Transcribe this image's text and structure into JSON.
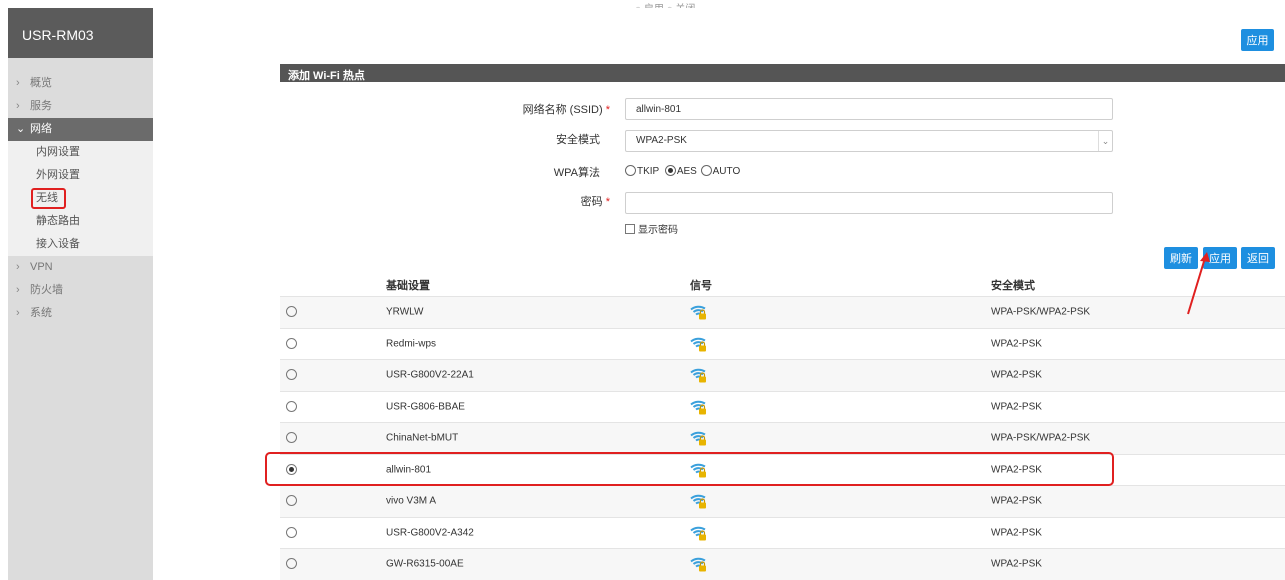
{
  "brand": "USR-RM03",
  "nav": {
    "overview": "概览",
    "services": "服务",
    "network": "网络",
    "network_sub": [
      "内网设置",
      "外网设置",
      "无线",
      "静态路由",
      "接入设备"
    ],
    "vpn": "VPN",
    "firewall": "防火墙",
    "system": "系统"
  },
  "top": {
    "apply_label": "应用",
    "cut_text": "○ 启用                          ○ 关闭"
  },
  "section": {
    "title": "添加 Wi-Fi 热点"
  },
  "form": {
    "ssid_label": "网络名称 (SSID)",
    "ssid_value": "allwin-801",
    "security_label": "安全模式",
    "security_value": "WPA2-PSK",
    "wpa_label": "WPA算法",
    "wpa_options": [
      "TKIP",
      "AES",
      "AUTO"
    ],
    "wpa_selected": "AES",
    "password_label": "密码",
    "password_value": "",
    "show_password_label": "显示密码",
    "required_mark": "*"
  },
  "buttons": {
    "refresh": "刷新",
    "apply": "应用",
    "back": "返回"
  },
  "table": {
    "headers": {
      "basic": "基础设置",
      "signal": "信号",
      "security": "安全模式"
    },
    "rows": [
      {
        "ssid": "YRWLW",
        "security": "WPA-PSK/WPA2-PSK",
        "selected": false
      },
      {
        "ssid": "Redmi-wps",
        "security": "WPA2-PSK",
        "selected": false
      },
      {
        "ssid": "USR-G800V2-22A1",
        "security": "WPA2-PSK",
        "selected": false
      },
      {
        "ssid": "USR-G806-BBAE",
        "security": "WPA2-PSK",
        "selected": false
      },
      {
        "ssid": "ChinaNet-bMUT",
        "security": "WPA-PSK/WPA2-PSK",
        "selected": false
      },
      {
        "ssid": "allwin-801",
        "security": "WPA2-PSK",
        "selected": true
      },
      {
        "ssid": "vivo V3M A",
        "security": "WPA2-PSK",
        "selected": false
      },
      {
        "ssid": "USR-G800V2-A342",
        "security": "WPA2-PSK",
        "selected": false
      },
      {
        "ssid": "GW-R6315-00AE",
        "security": "WPA2-PSK",
        "selected": false
      }
    ]
  },
  "colors": {
    "accent": "#1e8fe0",
    "annotation": "#e02020",
    "sidebar_header": "#5b5b5b",
    "signal_blue": "#3aa0dc",
    "signal_lock": "#e8b400"
  }
}
